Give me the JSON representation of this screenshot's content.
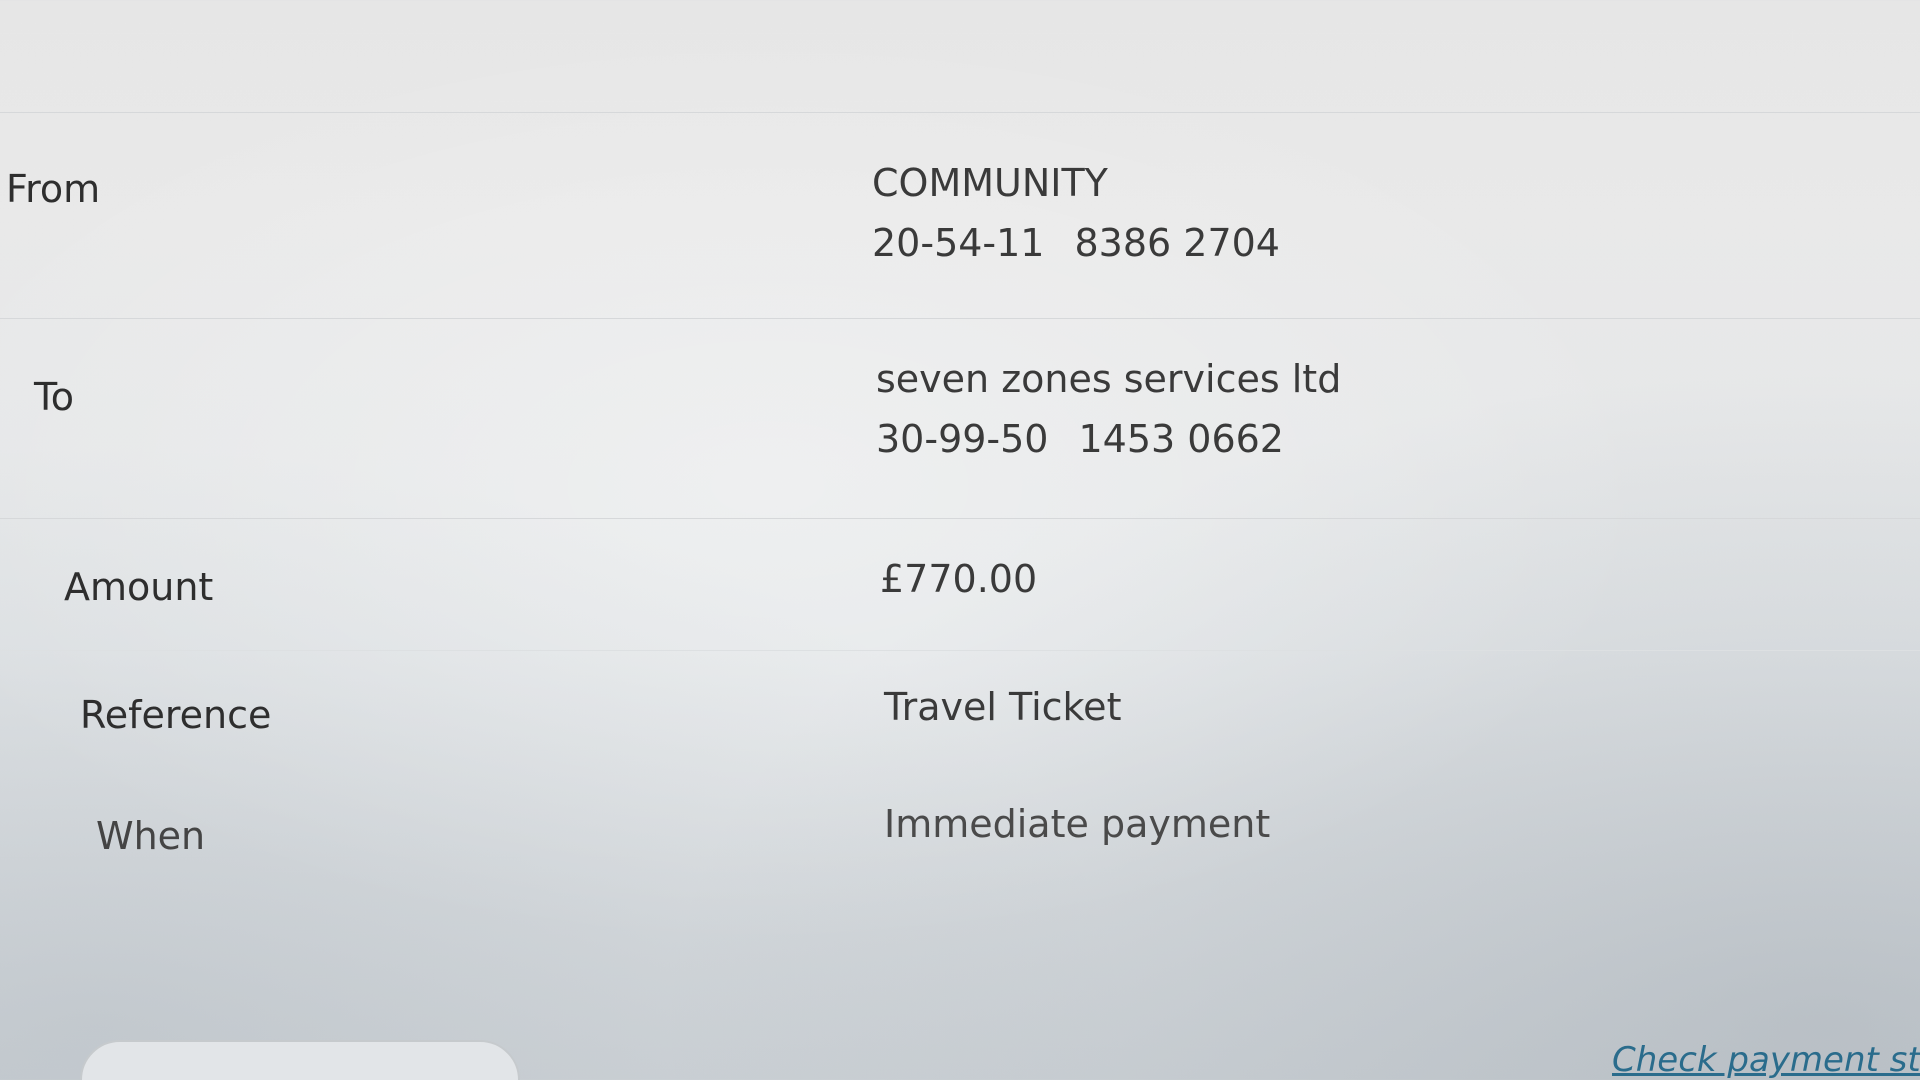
{
  "payment": {
    "from": {
      "label": "From",
      "account_name": "COMMUNITY",
      "sort_code": "20-54-11",
      "account_number": "8386 2704"
    },
    "to": {
      "label": "To",
      "payee_name": "seven zones services ltd",
      "sort_code": "30-99-50",
      "account_number": "1453 0662"
    },
    "amount": {
      "label": "Amount",
      "value": "£770.00"
    },
    "reference": {
      "label": "Reference",
      "value": "Travel Ticket"
    },
    "when": {
      "label": "When",
      "value": "Immediate payment"
    }
  },
  "actions": {
    "check_status_link": "Check payment statu"
  },
  "colors": {
    "link": "#2a6c8c",
    "text": "#333333",
    "divider": "#d6d8da"
  }
}
